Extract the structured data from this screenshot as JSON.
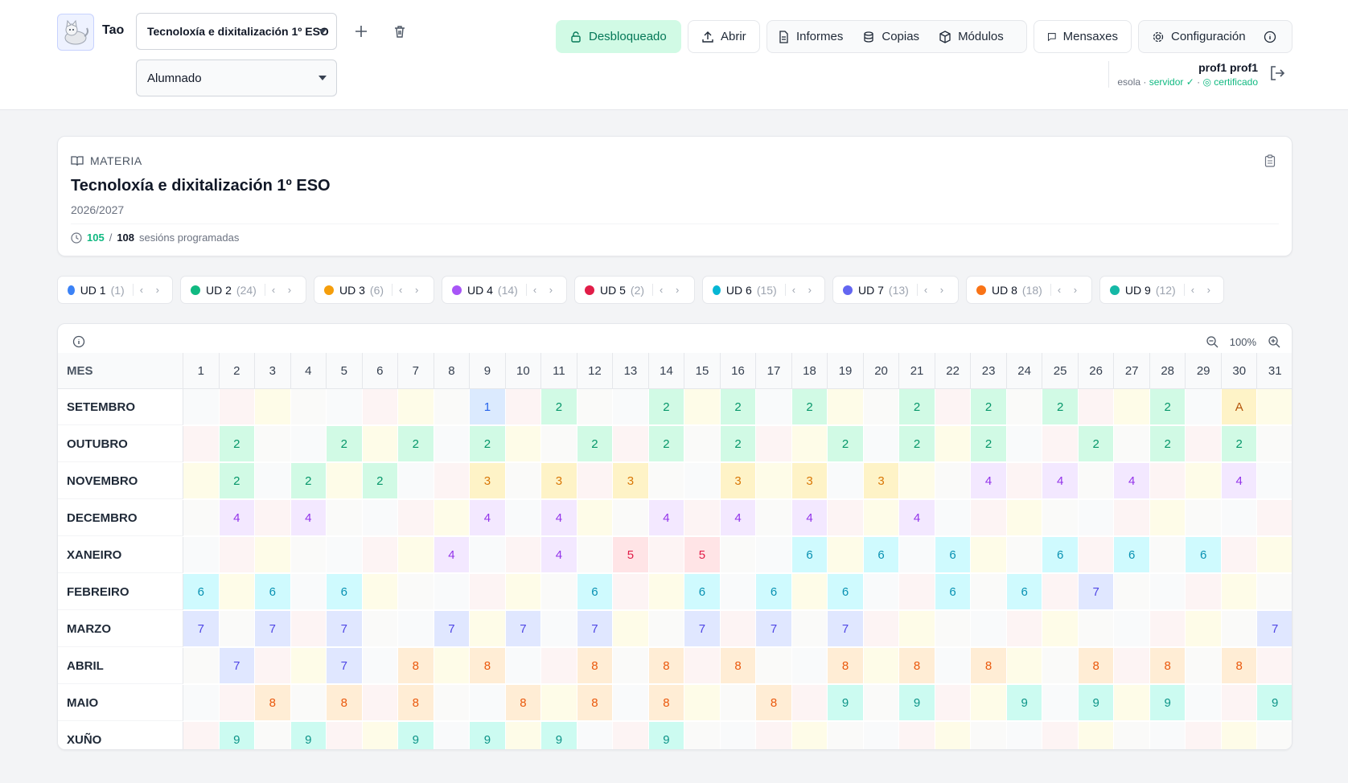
{
  "header": {
    "username": "Tao",
    "subject_select": "Tecnoloxía e dixitalización 1º ESO",
    "role_select": "Alumnado",
    "buttons": {
      "unlocked": "Desbloqueado",
      "open": "Abrir",
      "reports": "Informes",
      "backups": "Copias",
      "modules": "Módulos",
      "messages": "Mensaxes",
      "settings": "Configuración"
    },
    "user": {
      "name": "prof1 prof1",
      "school": "esola",
      "server": "servidor ✓",
      "certificate": "certificado"
    }
  },
  "subject_card": {
    "label": "MATERIA",
    "title": "Tecnoloxía e dixitalización 1º ESO",
    "year": "2026/2027",
    "sessions_done": "105",
    "sessions_total": "108",
    "sessions_label": "sesións programadas"
  },
  "units": [
    {
      "label": "UD 1",
      "count": "(1)",
      "color": "#3b82f6"
    },
    {
      "label": "UD 2",
      "count": "(24)",
      "color": "#10b981"
    },
    {
      "label": "UD 3",
      "count": "(6)",
      "color": "#f59e0b"
    },
    {
      "label": "UD 4",
      "count": "(14)",
      "color": "#a855f7"
    },
    {
      "label": "UD 5",
      "count": "(2)",
      "color": "#e11d48"
    },
    {
      "label": "UD 6",
      "count": "(15)",
      "color": "#06b6d4"
    },
    {
      "label": "UD 7",
      "count": "(13)",
      "color": "#6366f1"
    },
    {
      "label": "UD 8",
      "count": "(18)",
      "color": "#f97316"
    },
    {
      "label": "UD 9",
      "count": "(12)",
      "color": "#14b8a6"
    }
  ],
  "calendar": {
    "zoom": "100%",
    "month_header": "MES",
    "days": [
      "1",
      "2",
      "3",
      "4",
      "5",
      "6",
      "7",
      "8",
      "9",
      "10",
      "11",
      "12",
      "13",
      "14",
      "15",
      "16",
      "17",
      "18",
      "19",
      "20",
      "21",
      "22",
      "23",
      "24",
      "25",
      "26",
      "27",
      "28",
      "29",
      "30",
      "31"
    ],
    "months": [
      "SETEMBRO",
      "OUTUBRO",
      "NOVEMBRO",
      "DECEMBRO",
      "XANEIRO",
      "FEBREIRO",
      "MARZO",
      "ABRIL",
      "MAIO",
      "XUÑO"
    ],
    "sessions": [
      [
        "",
        "",
        "",
        "",
        "",
        "",
        "",
        "",
        "1",
        "",
        "2",
        "",
        "",
        "2",
        "",
        "2",
        "",
        "2",
        "",
        "",
        "2",
        "",
        "2",
        "",
        "2",
        "",
        "",
        "2",
        "",
        "A",
        ""
      ],
      [
        "",
        "2",
        "",
        "",
        "2",
        "",
        "2",
        "",
        "2",
        "",
        "",
        "2",
        "",
        "2",
        "",
        "2",
        "",
        "",
        "2",
        "",
        "2",
        "",
        "2",
        "",
        "",
        "2",
        "",
        "2",
        "",
        "2",
        ""
      ],
      [
        "",
        "2",
        "",
        "2",
        "",
        "2",
        "",
        "",
        "3",
        "",
        "3",
        "",
        "3",
        "",
        "",
        "3",
        "",
        "3",
        "",
        "3",
        "",
        "",
        "4",
        "",
        "4",
        "",
        "4",
        "",
        "",
        "4",
        ""
      ],
      [
        "",
        "4",
        "",
        "4",
        "",
        "",
        "",
        "",
        "4",
        "",
        "4",
        "",
        "",
        "4",
        "",
        "4",
        "",
        "4",
        "",
        "",
        "4",
        "",
        "",
        "",
        "",
        "",
        "",
        "",
        "",
        "",
        ""
      ],
      [
        "",
        "",
        "",
        "",
        "",
        "",
        "",
        "4",
        "",
        "",
        "4",
        "",
        "5",
        "",
        "5",
        "",
        "",
        "6",
        "",
        "6",
        "",
        "6",
        "",
        "",
        "6",
        "",
        "6",
        "",
        "6",
        "",
        ""
      ],
      [
        "6",
        "",
        "6",
        "",
        "6",
        "",
        "",
        "",
        "",
        "",
        "",
        "6",
        "",
        "",
        "6",
        "",
        "6",
        "",
        "6",
        "",
        "",
        "6",
        "",
        "6",
        "",
        "7",
        "",
        "",
        "",
        "",
        ""
      ],
      [
        "7",
        "",
        "7",
        "",
        "7",
        "",
        "",
        "7",
        "",
        "7",
        "",
        "7",
        "",
        "",
        "7",
        "",
        "7",
        "",
        "7",
        "",
        "",
        "",
        "",
        "",
        "",
        "",
        "",
        "",
        "",
        "",
        "7"
      ],
      [
        "",
        "7",
        "",
        "",
        "7",
        "",
        "8",
        "",
        "8",
        "",
        "",
        "8",
        "",
        "8",
        "",
        "8",
        "",
        "",
        "8",
        "",
        "8",
        "",
        "8",
        "",
        "",
        "8",
        "",
        "8",
        "",
        "8",
        ""
      ],
      [
        "",
        "",
        "8",
        "",
        "8",
        "",
        "8",
        "",
        "",
        "8",
        "",
        "8",
        "",
        "8",
        "",
        "",
        "8",
        "",
        "9",
        "",
        "9",
        "",
        "",
        "9",
        "",
        "9",
        "",
        "9",
        "",
        "",
        "9"
      ],
      [
        "",
        "9",
        "",
        "9",
        "",
        "",
        "9",
        "",
        "9",
        "",
        "9",
        "",
        "",
        "9",
        "",
        "",
        "",
        "",
        "",
        "",
        "",
        "",
        "",
        "",
        "",
        "",
        "",
        "",
        "",
        "",
        ""
      ]
    ],
    "unit_colors": {
      "1": {
        "bg": "#dbeafe",
        "fg": "#2563eb"
      },
      "2": {
        "bg": "#d1fae5",
        "fg": "#059669"
      },
      "3": {
        "bg": "#fef3c7",
        "fg": "#d97706"
      },
      "4": {
        "bg": "#f3e8ff",
        "fg": "#9333ea"
      },
      "5": {
        "bg": "#ffe4e6",
        "fg": "#e11d48"
      },
      "6": {
        "bg": "#cffafe",
        "fg": "#0891b2"
      },
      "7": {
        "bg": "#e0e7ff",
        "fg": "#4f46e5"
      },
      "8": {
        "bg": "#ffedd5",
        "fg": "#ea580c"
      },
      "9": {
        "bg": "#ccfbf1",
        "fg": "#0d9488"
      },
      "A": {
        "bg": "#fef3c7",
        "fg": "#b45309"
      }
    }
  }
}
